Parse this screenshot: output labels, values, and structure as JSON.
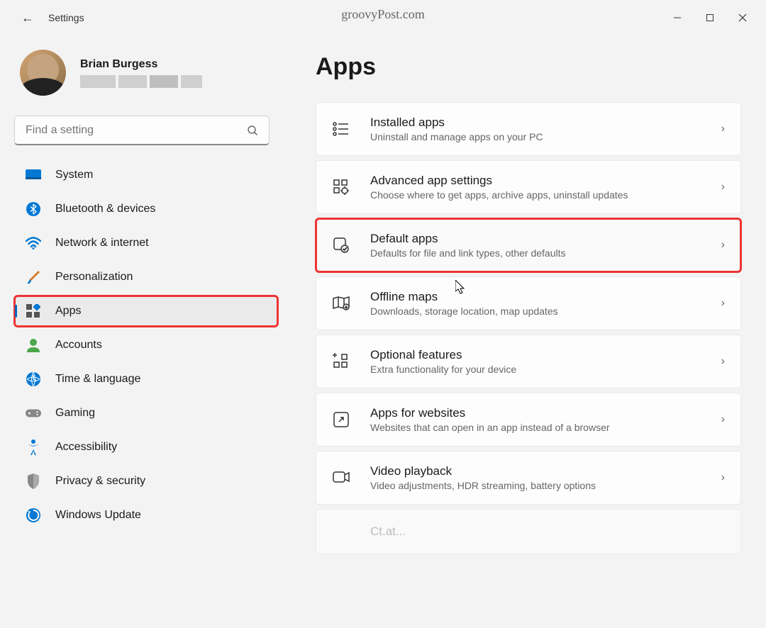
{
  "app": {
    "title": "Settings",
    "watermark": "groovyPost.com"
  },
  "profile": {
    "name": "Brian Burgess"
  },
  "search": {
    "placeholder": "Find a setting"
  },
  "sidebar": {
    "items": [
      {
        "label": "System",
        "icon": "system-icon"
      },
      {
        "label": "Bluetooth & devices",
        "icon": "bluetooth-icon"
      },
      {
        "label": "Network & internet",
        "icon": "wifi-icon"
      },
      {
        "label": "Personalization",
        "icon": "brush-icon"
      },
      {
        "label": "Apps",
        "icon": "apps-icon"
      },
      {
        "label": "Accounts",
        "icon": "account-icon"
      },
      {
        "label": "Time & language",
        "icon": "time-icon"
      },
      {
        "label": "Gaming",
        "icon": "gaming-icon"
      },
      {
        "label": "Accessibility",
        "icon": "accessibility-icon"
      },
      {
        "label": "Privacy & security",
        "icon": "shield-icon"
      },
      {
        "label": "Windows Update",
        "icon": "update-icon"
      }
    ],
    "selected_index": 4,
    "highlighted_index": 4
  },
  "main": {
    "title": "Apps",
    "highlighted_index": 2,
    "cards": [
      {
        "title": "Installed apps",
        "sub": "Uninstall and manage apps on your PC"
      },
      {
        "title": "Advanced app settings",
        "sub": "Choose where to get apps, archive apps, uninstall updates"
      },
      {
        "title": "Default apps",
        "sub": "Defaults for file and link types, other defaults"
      },
      {
        "title": "Offline maps",
        "sub": "Downloads, storage location, map updates"
      },
      {
        "title": "Optional features",
        "sub": "Extra functionality for your device"
      },
      {
        "title": "Apps for websites",
        "sub": "Websites that can open in an app instead of a browser"
      },
      {
        "title": "Video playback",
        "sub": "Video adjustments, HDR streaming, battery options"
      }
    ]
  }
}
